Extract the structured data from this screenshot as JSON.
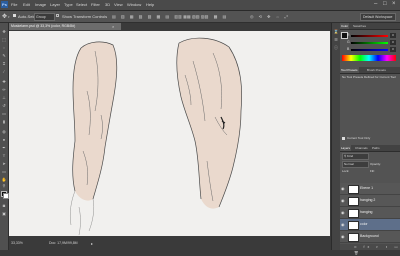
{
  "app": {
    "logo": "Ps"
  },
  "menu": [
    "File",
    "Edit",
    "Image",
    "Layer",
    "Type",
    "Select",
    "Filter",
    "3D",
    "View",
    "Window",
    "Help"
  ],
  "window_controls": {
    "minimize": "–",
    "maximize": "□",
    "close": "×"
  },
  "options_bar": {
    "auto_select_label": "Auto-Select:",
    "auto_select_value": "Group",
    "transform_label": "Show Transform Controls",
    "workspace": "Default Workspace"
  },
  "document": {
    "tab_title": "Muskelarm.psd @ 33,3% (color, RGB/8#)",
    "close": "×"
  },
  "status": {
    "zoom": "33,33%",
    "doc_info": "Doc: 17,9M/99,8M"
  },
  "color_panel": {
    "tabs": [
      "Color",
      "Swatches"
    ],
    "channels": [
      {
        "label": "R",
        "value": "0"
      },
      {
        "label": "G",
        "value": "0"
      },
      {
        "label": "B",
        "value": "0"
      }
    ]
  },
  "tool_presets_panel": {
    "tabs": [
      "Tool Presets",
      "Brush Presets"
    ],
    "message": "No Tool Presets Defined for Current Tool",
    "checkbox_label": "Current Tool Only"
  },
  "layers_panel": {
    "tabs": [
      "Layers",
      "Channels",
      "Paths"
    ],
    "blend_mode": "Normal",
    "opacity_label": "Opacity:",
    "lock_label": "Lock:",
    "fill_label": "Fill:",
    "layers": [
      {
        "name": "Ebene 1",
        "selected": false
      },
      {
        "name": "hanging 2",
        "selected": false
      },
      {
        "name": "hanging",
        "selected": false
      },
      {
        "name": "color",
        "selected": true
      },
      {
        "name": "Background",
        "selected": false
      }
    ]
  },
  "colors": {
    "menubar": "#4a4a4a",
    "canvas": "#f1f0ee",
    "skin_tone": "#ead9cd",
    "selected_layer": "#5e6f8a"
  }
}
